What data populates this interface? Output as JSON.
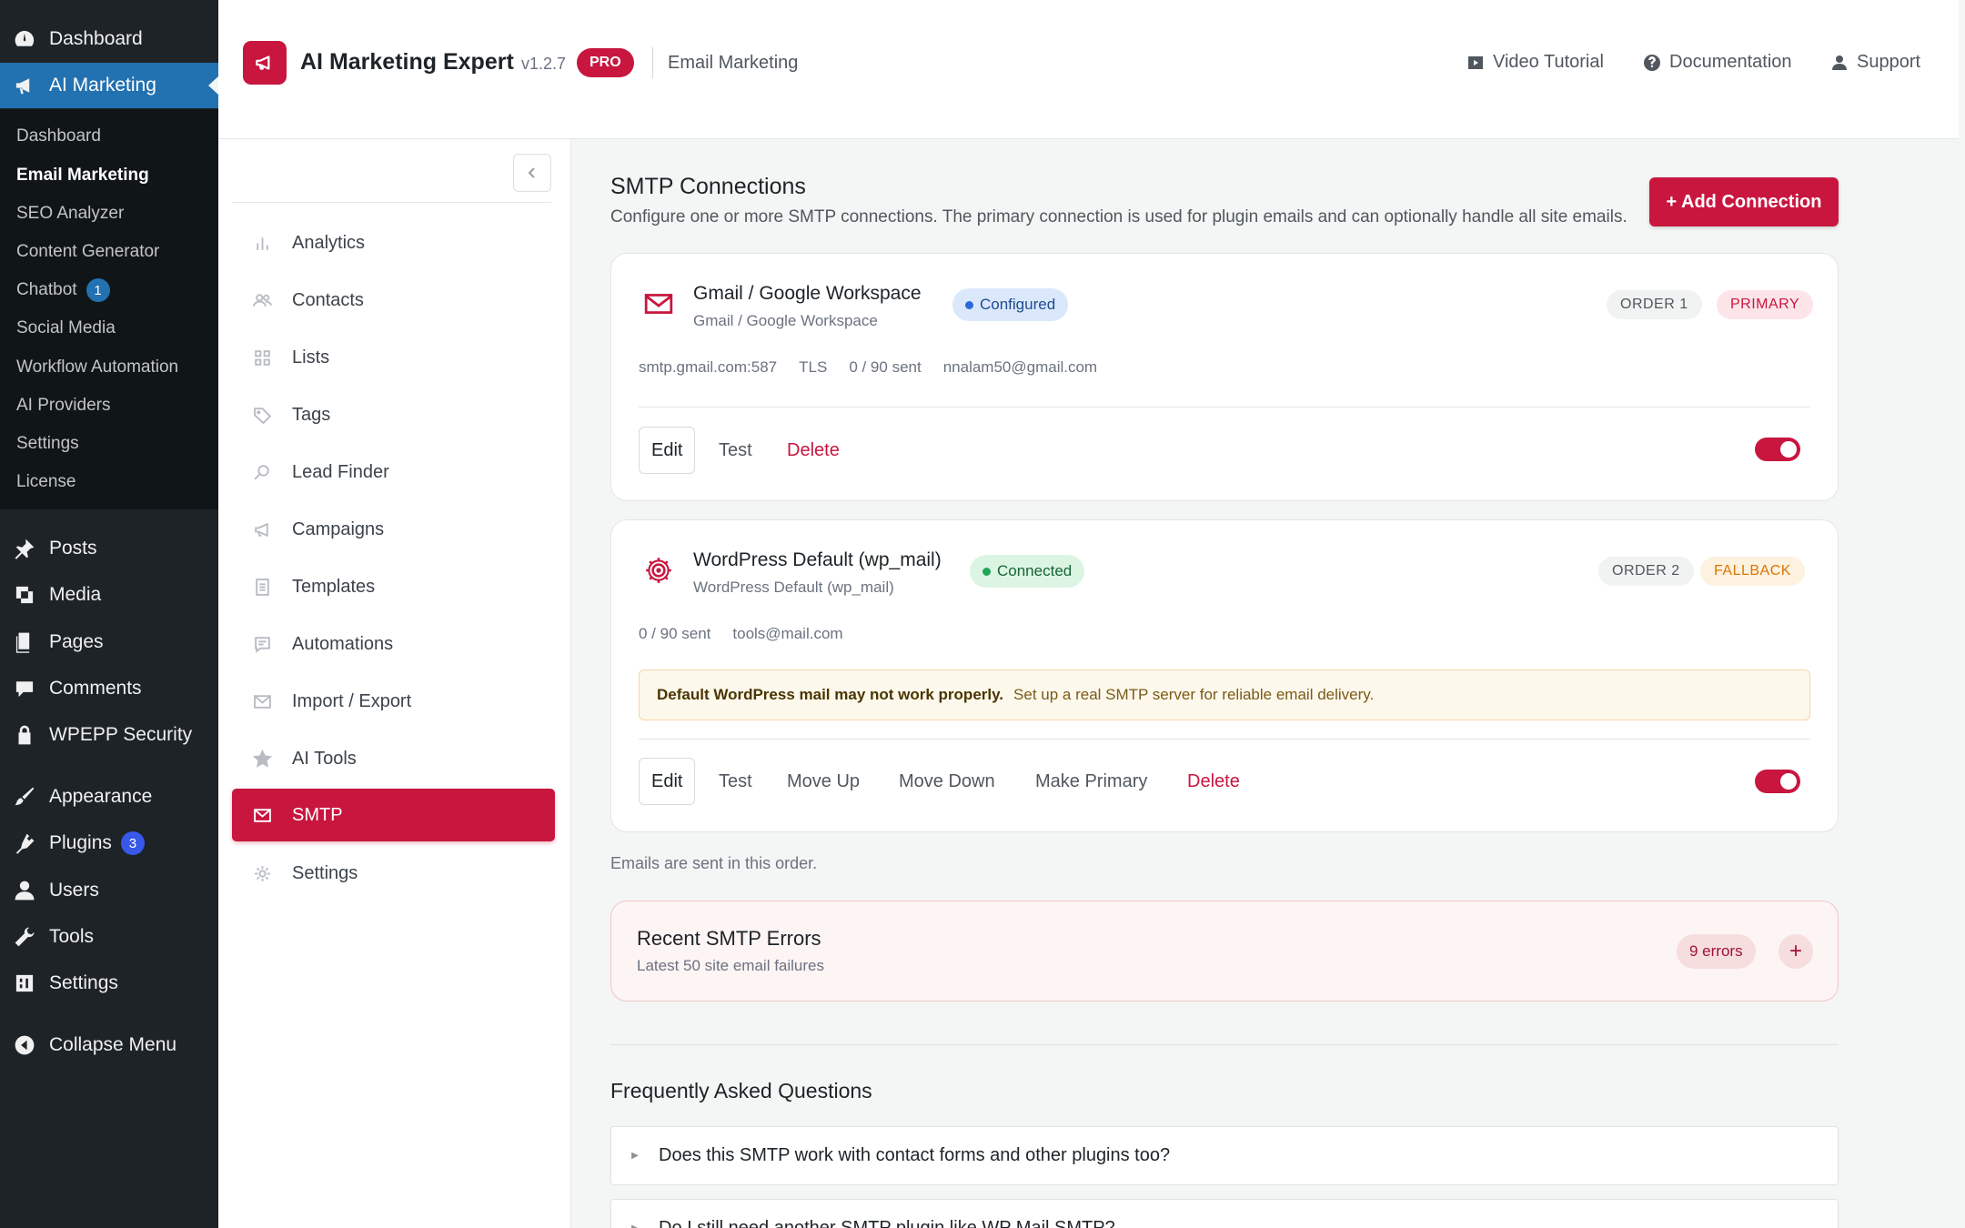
{
  "wp_menu": {
    "top": [
      {
        "label": "Dashboard",
        "icon": "dashboard-icon"
      },
      {
        "label": "AI Marketing",
        "icon": "megaphone-icon",
        "active": true
      }
    ],
    "submenu": [
      {
        "label": "Dashboard"
      },
      {
        "label": "Email Marketing",
        "current": true
      },
      {
        "label": "SEO Analyzer"
      },
      {
        "label": "Content Generator"
      },
      {
        "label": "Chatbot",
        "badge": "1"
      },
      {
        "label": "Social Media"
      },
      {
        "label": "Workflow Automation"
      },
      {
        "label": "AI Providers"
      },
      {
        "label": "Settings"
      },
      {
        "label": "License"
      }
    ],
    "items": [
      {
        "label": "Posts",
        "icon": "pin-icon"
      },
      {
        "label": "Media",
        "icon": "media-icon"
      },
      {
        "label": "Pages",
        "icon": "pages-icon"
      },
      {
        "label": "Comments",
        "icon": "comment-icon"
      },
      {
        "label": "WPEPP Security",
        "icon": "lock-icon"
      },
      {
        "label": "Appearance",
        "icon": "brush-icon"
      },
      {
        "label": "Plugins",
        "icon": "plugin-icon",
        "badge": "3"
      },
      {
        "label": "Users",
        "icon": "user-icon"
      },
      {
        "label": "Tools",
        "icon": "wrench-icon"
      },
      {
        "label": "Settings",
        "icon": "settings-icon"
      },
      {
        "label": "Collapse Menu",
        "icon": "collapse-icon"
      }
    ]
  },
  "header": {
    "title": "AI Marketing Expert",
    "version": "v1.2.7",
    "pro": "PRO",
    "section": "Email Marketing",
    "links": [
      {
        "label": "Video Tutorial",
        "icon": "video-icon"
      },
      {
        "label": "Documentation",
        "icon": "help-icon"
      },
      {
        "label": "Support",
        "icon": "support-icon"
      }
    ]
  },
  "plugin_nav": {
    "items": [
      {
        "label": "Analytics",
        "icon": "bar-chart-icon"
      },
      {
        "label": "Contacts",
        "icon": "users-icon"
      },
      {
        "label": "Lists",
        "icon": "grid-icon"
      },
      {
        "label": "Tags",
        "icon": "tag-icon"
      },
      {
        "label": "Lead Finder",
        "icon": "search-icon"
      },
      {
        "label": "Campaigns",
        "icon": "megaphone-icon"
      },
      {
        "label": "Templates",
        "icon": "document-icon"
      },
      {
        "label": "Automations",
        "icon": "message-icon"
      },
      {
        "label": "Import / Export",
        "icon": "mail-icon"
      },
      {
        "label": "AI Tools",
        "icon": "star-icon"
      },
      {
        "label": "SMTP",
        "icon": "mail-icon",
        "active": true
      },
      {
        "label": "Settings",
        "icon": "gear-icon"
      }
    ]
  },
  "smtp": {
    "title": "SMTP Connections",
    "description": "Configure one or more SMTP connections. The primary connection is used for plugin emails and can optionally handle all site emails.",
    "add_button": "+ Add Connection",
    "connections": [
      {
        "name": "Gmail / Google Workspace",
        "subtitle": "Gmail / Google Workspace",
        "status": "Configured",
        "order": "ORDER 1",
        "role": "PRIMARY",
        "meta": [
          "smtp.gmail.com:587",
          "TLS",
          "0 / 90 sent",
          "nnalam50@gmail.com"
        ],
        "actions": {
          "edit": "Edit",
          "test": "Test",
          "delete": "Delete"
        },
        "enabled": true
      },
      {
        "name": "WordPress Default (wp_mail)",
        "subtitle": "WordPress Default (wp_mail)",
        "status": "Connected",
        "order": "ORDER 2",
        "role": "FALLBACK",
        "meta": [
          "0 / 90 sent",
          "tools@mail.com"
        ],
        "warning_bold": "Default WordPress mail may not work properly.",
        "warning_text": "Set up a real SMTP server for reliable email delivery.",
        "actions": {
          "edit": "Edit",
          "test": "Test",
          "move_up": "Move Up",
          "move_down": "Move Down",
          "make_primary": "Make Primary",
          "delete": "Delete"
        },
        "enabled": true
      }
    ],
    "order_note": "Emails are sent in this order."
  },
  "errors": {
    "title": "Recent SMTP Errors",
    "subtitle": "Latest 50 site email failures",
    "count": "9 errors",
    "expand": "+"
  },
  "faq": {
    "title": "Frequently Asked Questions",
    "items": [
      "Does this SMTP work with contact forms and other plugins too?",
      "Do I still need another SMTP plugin like WP Mail SMTP?"
    ]
  },
  "colors": {
    "brand": "#c8163f",
    "wp_sidebar": "#1d2327",
    "wp_active": "#2271b1"
  }
}
